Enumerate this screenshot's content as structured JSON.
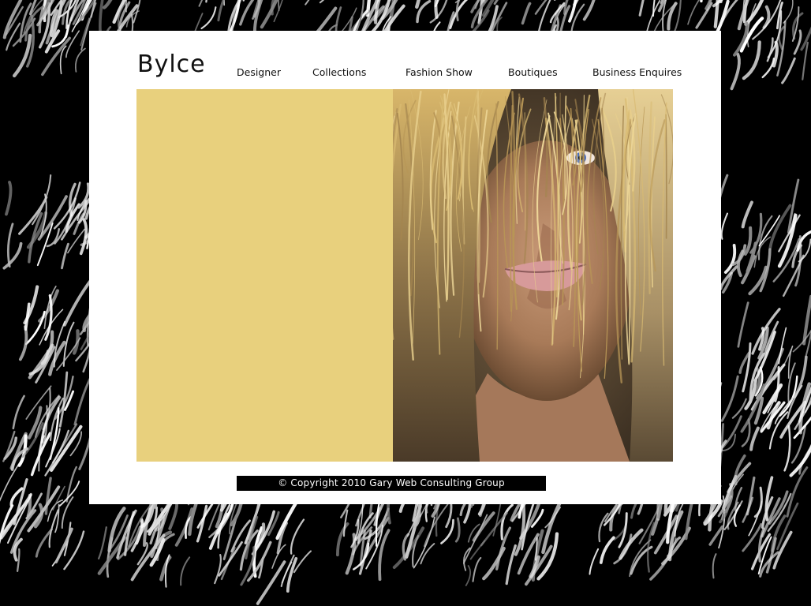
{
  "site": {
    "logo": "Bylce"
  },
  "nav": {
    "items": [
      {
        "label": "Designer"
      },
      {
        "label": "Collections"
      },
      {
        "label": "Fashion Show"
      },
      {
        "label": "Boutiques"
      },
      {
        "label": "Business Enquires"
      }
    ]
  },
  "footer": {
    "copyright": "© Copyright  2010  Gary Web Consulting Group"
  },
  "colors": {
    "background": "#000000",
    "panel": "#ffffff",
    "gold_block": "#e8d07d",
    "footer_bar": "#000000"
  }
}
